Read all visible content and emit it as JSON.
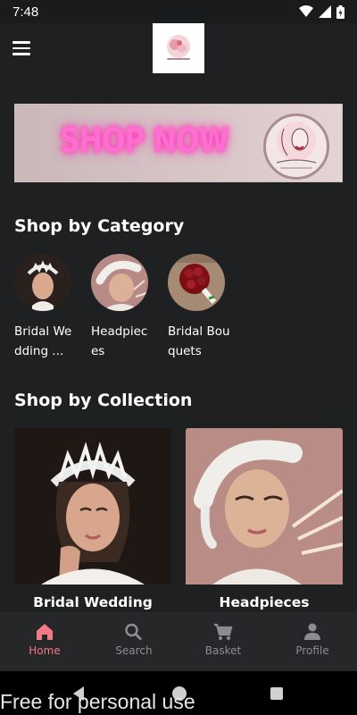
{
  "status_bar": {
    "time": "7:48"
  },
  "banner": {
    "text": "SHOP NOW"
  },
  "sections": {
    "category_title": "Shop by Category",
    "collection_title": "Shop by Collection"
  },
  "categories": [
    {
      "label": "Bridal Wedding ..."
    },
    {
      "label": "Headpieces"
    },
    {
      "label": "Bridal Bouquets"
    }
  ],
  "collections": [
    {
      "label": "Bridal Wedding Crown"
    },
    {
      "label": "Headpieces"
    }
  ],
  "bottom_nav": [
    {
      "label": "Home",
      "icon": "home-icon",
      "active": true
    },
    {
      "label": "Search",
      "icon": "search-icon",
      "active": false
    },
    {
      "label": "Basket",
      "icon": "cart-icon",
      "active": false
    },
    {
      "label": "Profile",
      "icon": "person-icon",
      "active": false
    }
  ],
  "watermark": "Free for personal use",
  "colors": {
    "background": "#1f2022",
    "accent": "#f07a85",
    "inactive": "#8c8d91",
    "nav_bg": "#262729"
  }
}
